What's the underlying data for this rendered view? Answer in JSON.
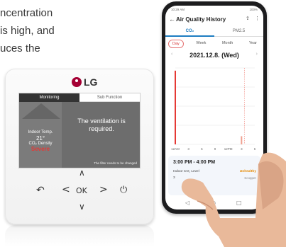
{
  "background_text": {
    "lines": [
      "ncentration",
      "is high, and",
      "uces the"
    ]
  },
  "controller": {
    "brand": "LG",
    "tabs": [
      "Monitoring",
      "Sub Function"
    ],
    "indoor_temp_label": "Indoor Temp.",
    "indoor_temp_value": "21°",
    "co2_label": "CO₂ Density",
    "co2_value": "Severe",
    "message": "The ventilation is required.",
    "note": "The filter needs to be changed",
    "buttons": {
      "up": "∧",
      "down": "∨",
      "left": "<",
      "right": ">",
      "ok": "OK",
      "back": "↶",
      "power": "⏻"
    }
  },
  "phone": {
    "status_time": "10:29 AM",
    "status_right": "100%",
    "title": "Air Quality History",
    "pollutant_tabs": [
      "CO₂",
      "PM2.5"
    ],
    "periods": [
      "Day",
      "Week",
      "Month",
      "Year"
    ],
    "date": "2021.12.8. (Wed)",
    "tip": {
      "time": "3:00 PM - 4:00 PM",
      "label": "Indoor CO₂ Level",
      "status": "Unhealthy",
      "value": "3",
      "unit": "Scopper"
    }
  },
  "colors": {
    "lg_red": "#a50034",
    "accent_blue": "#1d7cc1",
    "severe_red": "#e53935",
    "unhealthy_orange": "#e68a00"
  },
  "chart_data": {
    "type": "bar",
    "categories": [
      "12AM",
      "3",
      "6",
      "9",
      "12PM",
      "3",
      "6"
    ],
    "series": [
      {
        "values": [
          1350,
          0,
          0,
          0,
          0,
          0,
          0
        ]
      },
      {
        "values": [
          0,
          0,
          0,
          0,
          0,
          150,
          0
        ]
      }
    ],
    "ylim": [
      0,
      1400
    ]
  }
}
